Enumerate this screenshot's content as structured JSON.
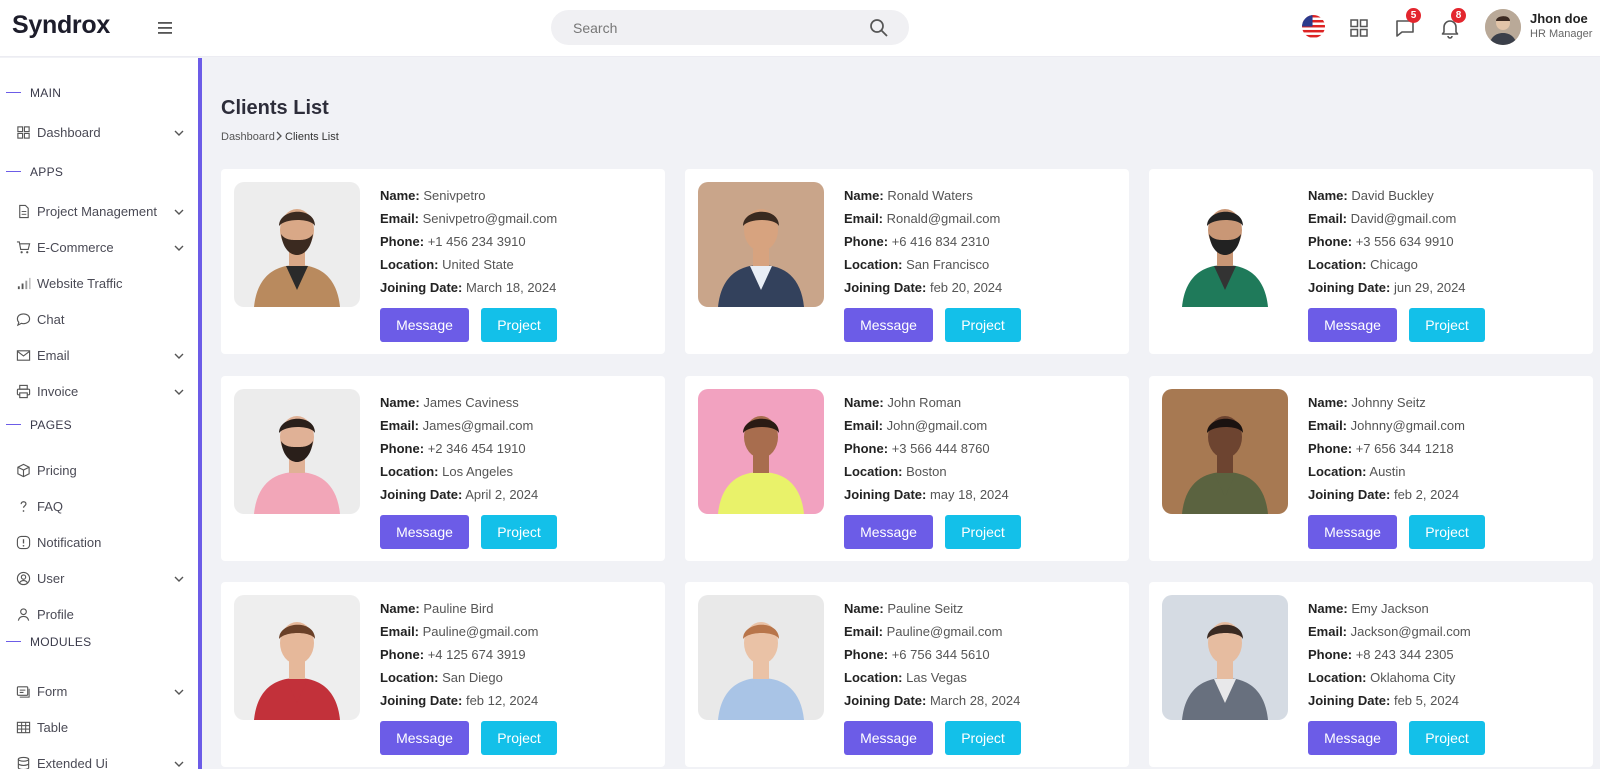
{
  "app": {
    "logo": "Syndrox"
  },
  "header": {
    "search_placeholder": "Search",
    "chat_badge": "5",
    "notif_badge": "8",
    "user_name": "Jhon doe",
    "user_role": "HR Manager"
  },
  "sidebar": {
    "sections": [
      "MAIN",
      "APPS",
      "PAGES",
      "MODULES"
    ],
    "items": [
      {
        "label": "Dashboard",
        "icon": "grid-icon"
      },
      {
        "label": "Project Management",
        "icon": "file-icon"
      },
      {
        "label": "E-Commerce",
        "icon": "cart-icon"
      },
      {
        "label": "Website Traffic",
        "icon": "bar-chart-icon"
      },
      {
        "label": "Chat",
        "icon": "chat-bubble-icon"
      },
      {
        "label": "Email",
        "icon": "mail-icon"
      },
      {
        "label": "Invoice",
        "icon": "printer-icon"
      },
      {
        "label": "Pricing",
        "icon": "package-icon"
      },
      {
        "label": "FAQ",
        "icon": "question-icon"
      },
      {
        "label": "Notification",
        "icon": "alert-icon"
      },
      {
        "label": "User",
        "icon": "user-circle-icon"
      },
      {
        "label": "Profile",
        "icon": "user-icon"
      },
      {
        "label": "Form",
        "icon": "form-icon"
      },
      {
        "label": "Table",
        "icon": "table-icon"
      },
      {
        "label": "Extended Ui",
        "icon": "database-icon"
      }
    ]
  },
  "main": {
    "title": "Clients List",
    "breadcrumb": {
      "home": "Dashboard",
      "current": "Clients List"
    }
  },
  "labels": {
    "name": "Name:",
    "email": "Email:",
    "phone": "Phone:",
    "location": "Location:",
    "joining": "Joining Date:",
    "message_btn": "Message",
    "project_btn": "Project"
  },
  "colors": {
    "accent": "#6c5ce7",
    "project": "#13c0e9",
    "badge": "#e3262e"
  },
  "clients": [
    {
      "name": "Senivpetro",
      "email": "Senivpetro@gmail.com",
      "phone": "+1 456 234 3910",
      "location": "United State",
      "joining": "March 18, 2024"
    },
    {
      "name": "Ronald Waters",
      "email": "Ronald@gmail.com",
      "phone": "+6 416 834 2310",
      "location": "San Francisco",
      "joining": "feb 20, 2024"
    },
    {
      "name": "David Buckley",
      "email": "David@gmail.com",
      "phone": "+3 556 634 9910",
      "location": "Chicago",
      "joining": "jun 29, 2024"
    },
    {
      "name": "James Caviness",
      "email": "James@gmail.com",
      "phone": "+2 346 454 1910",
      "location": "Los Angeles",
      "joining": "April 2, 2024"
    },
    {
      "name": "John Roman",
      "email": "John@gmail.com",
      "phone": "+3 566 444 8760",
      "location": "Boston",
      "joining": "may 18, 2024"
    },
    {
      "name": "Johnny Seitz",
      "email": "Johnny@gmail.com",
      "phone": "+7 656 344 1218",
      "location": "Austin",
      "joining": "feb 2, 2024"
    },
    {
      "name": "Pauline Bird",
      "email": "Pauline@gmail.com",
      "phone": "+4 125 674 3919",
      "location": "San Diego",
      "joining": "feb 12, 2024"
    },
    {
      "name": "Pauline Seitz",
      "email": "Pauline@gmail.com",
      "phone": "+6 756 344 5610",
      "location": "Las Vegas",
      "joining": "March 28, 2024"
    },
    {
      "name": "Emy Jackson",
      "email": "Jackson@gmail.com",
      "phone": "+8 243 344 2305",
      "location": "Oklahoma City",
      "joining": "feb 5, 2024"
    }
  ]
}
